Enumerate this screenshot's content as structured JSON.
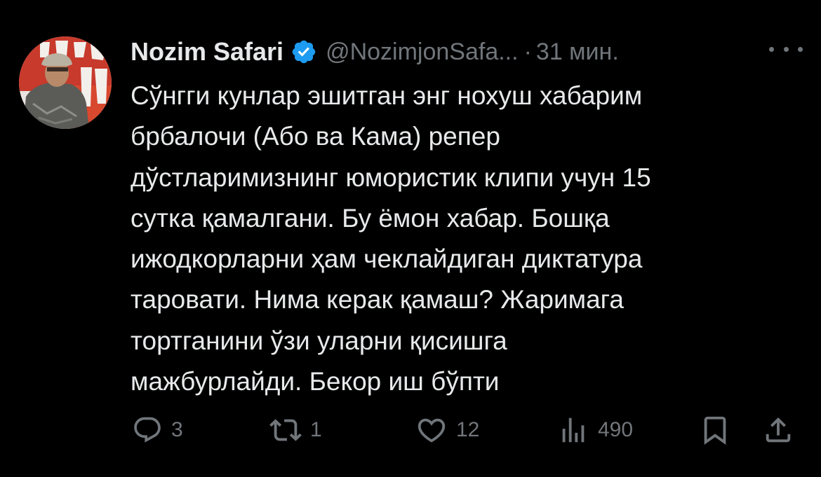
{
  "tweet": {
    "author": {
      "display_name": "Nozim Safari",
      "handle": "@NozimjonSafa...",
      "verified": true,
      "avatar_icon": "avatar-photo"
    },
    "separator": "·",
    "time": "31 мин.",
    "more_icon": "ellipsis-icon",
    "text_lines": [
      "Сўнгги кунлар эшитган энг нохуш хабарим",
      "брбалочи (Або ва Кама) репер",
      "дўстларимизнинг юмористик клипи учун 15",
      "сутка қамалгани. Бу ёмон хабар. Бошқа",
      "ижодкорларни ҳам чеклайдиган диктатура",
      "таровати. Нима керак қамаш? Жаримага",
      "тортганини ўзи уларни қисишга",
      "мажбурлайди. Бекор иш бўпти"
    ],
    "actions": {
      "reply": {
        "icon": "reply-icon",
        "count": "3"
      },
      "retweet": {
        "icon": "retweet-icon",
        "count": "1"
      },
      "like": {
        "icon": "heart-icon",
        "count": "12"
      },
      "views": {
        "icon": "views-icon",
        "count": "490"
      },
      "bookmark": {
        "icon": "bookmark-icon"
      },
      "share": {
        "icon": "share-icon"
      }
    }
  },
  "colors": {
    "background": "#000000",
    "text_primary": "#e7e9ea",
    "text_secondary": "#71767b",
    "verified_blue": "#1d9bf0"
  }
}
